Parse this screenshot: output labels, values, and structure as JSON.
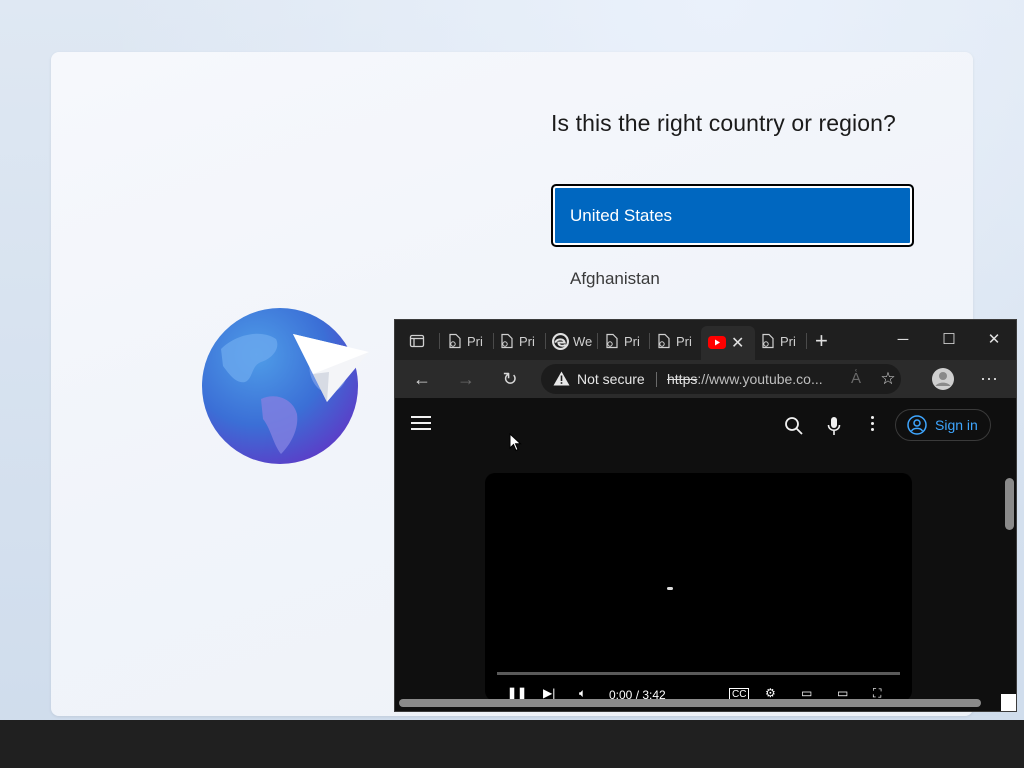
{
  "oobe": {
    "title": "Is this the right country or region?",
    "selected_country": "United States",
    "countries": [
      "Afghanistan"
    ]
  },
  "browser": {
    "tabs": [
      {
        "label": "Pri",
        "icon": "page-icon"
      },
      {
        "label": "Pri",
        "icon": "page-icon"
      },
      {
        "label": "We",
        "icon": "edge-icon"
      },
      {
        "label": "Pri",
        "icon": "page-icon"
      },
      {
        "label": "Pri",
        "icon": "page-icon"
      },
      {
        "label": "",
        "icon": "youtube-icon",
        "active": true
      },
      {
        "label": "Pri",
        "icon": "page-icon"
      }
    ],
    "address": {
      "security": "Not secure",
      "scheme": "https",
      "rest": "://www.youtube.co..."
    },
    "youtube": {
      "sign_in": "Sign in",
      "time": "0:00 / 3:42"
    }
  },
  "colors": {
    "accent": "#0067c0",
    "youtube_blue": "#3ea6ff",
    "youtube_red": "#ff0000"
  }
}
